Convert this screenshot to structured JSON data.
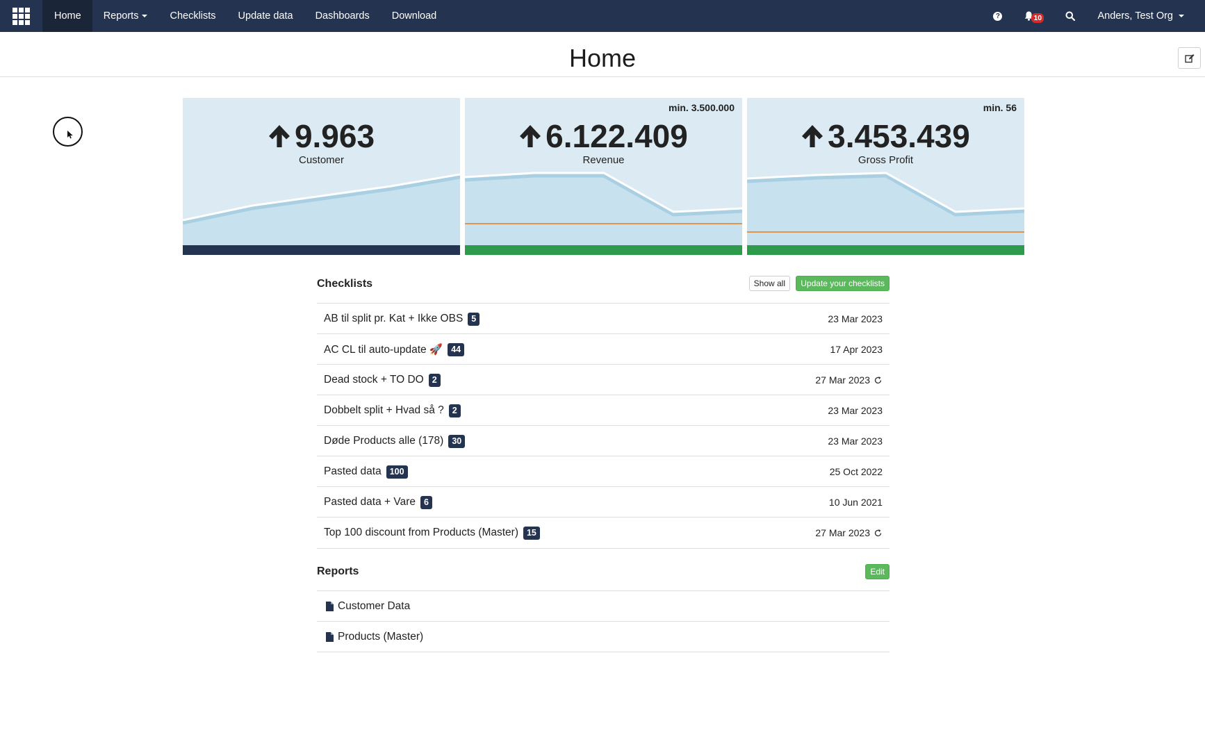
{
  "nav": {
    "apps_icon": "grid-icon",
    "items": [
      {
        "label": "Home",
        "active": true
      },
      {
        "label": "Reports",
        "dropdown": true
      },
      {
        "label": "Checklists"
      },
      {
        "label": "Update data"
      },
      {
        "label": "Dashboards"
      },
      {
        "label": "Download"
      }
    ],
    "help_icon": "question-circle-icon",
    "notifications_icon": "bell-icon",
    "notifications_count": "10",
    "search_icon": "search-icon",
    "user": "Anders, Test Org"
  },
  "page": {
    "title": "Home",
    "edit_icon": "edit-icon"
  },
  "kpis": [
    {
      "value": "9.963",
      "label": "Customer",
      "min": "",
      "trend": "up",
      "bar_color": "#24334f"
    },
    {
      "value": "6.122.409",
      "label": "Revenue",
      "min": "min. 3.500.000",
      "trend": "up",
      "bar_color": "#2e9a4c"
    },
    {
      "value": "3.453.439",
      "label": "Gross Profit",
      "min": "min. 56",
      "trend": "up",
      "bar_color": "#2e9a4c"
    }
  ],
  "checklists": {
    "title": "Checklists",
    "show_all_label": "Show all",
    "update_label": "Update your checklists",
    "items": [
      {
        "name": "AB til split pr. Kat + Ikke OBS",
        "count": "5",
        "date": "23 Mar 2023",
        "auto": false
      },
      {
        "name": "AC CL til auto-update 🚀",
        "count": "44",
        "date": "17 Apr 2023",
        "auto": false
      },
      {
        "name": "Dead stock + TO DO",
        "count": "2",
        "date": "27 Mar 2023",
        "auto": true
      },
      {
        "name": "Dobbelt split + Hvad så ?",
        "count": "2",
        "date": "23 Mar 2023",
        "auto": false
      },
      {
        "name": "Døde Products alle (178)",
        "count": "30",
        "date": "23 Mar 2023",
        "auto": false
      },
      {
        "name": "Pasted data",
        "count": "100",
        "date": "25 Oct 2022",
        "auto": false
      },
      {
        "name": "Pasted data + Vare",
        "count": "6",
        "date": "10 Jun 2021",
        "auto": false
      },
      {
        "name": "Top 100 discount from Products (Master)",
        "count": "15",
        "date": "27 Mar 2023",
        "auto": true
      }
    ]
  },
  "reports": {
    "title": "Reports",
    "edit_label": "Edit",
    "items": [
      {
        "name": "Customer Data"
      },
      {
        "name": "Products (Master)"
      }
    ]
  },
  "colors": {
    "navbar": "#24334f",
    "card_bg": "#dcebf3",
    "success": "#5cb85c",
    "threshold_line": "#e0954a"
  }
}
